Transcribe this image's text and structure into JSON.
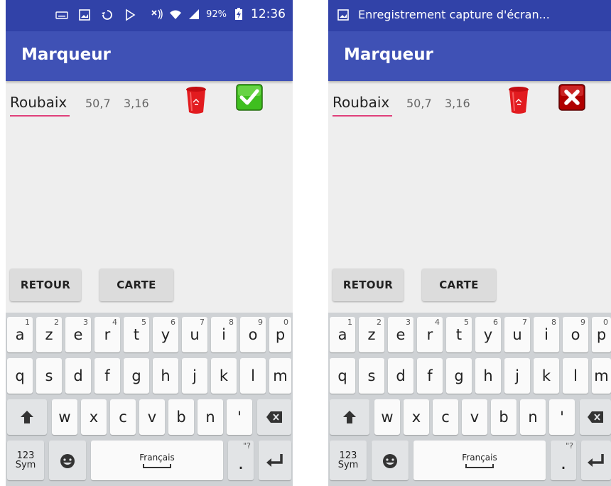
{
  "app": {
    "title": "Marqueur"
  },
  "status_bar": {
    "battery": "92%",
    "time": "12:36"
  },
  "notification": {
    "text": "Enregistrement capture d'écran..."
  },
  "marker": {
    "name": "Roubaix",
    "lat": "50,7",
    "lon": "3,16"
  },
  "icons": {
    "delete": "trash-icon",
    "valid": "check-icon",
    "invalid": "close-icon"
  },
  "colors": {
    "app_bar": "#3f51b5",
    "status_bar": "#3142a8",
    "input_underline": "#e0407a",
    "check_green": "#3fbf1f",
    "error_red": "#b00000"
  },
  "buttons": {
    "back": "RETOUR",
    "map": "CARTE"
  },
  "keyboard": {
    "row1": [
      {
        "key": "a",
        "hint": "1"
      },
      {
        "key": "z",
        "hint": "2"
      },
      {
        "key": "e",
        "hint": "3"
      },
      {
        "key": "r",
        "hint": "4"
      },
      {
        "key": "t",
        "hint": "5"
      },
      {
        "key": "y",
        "hint": "6"
      },
      {
        "key": "u",
        "hint": "7"
      },
      {
        "key": "i",
        "hint": "8"
      },
      {
        "key": "o",
        "hint": "9"
      },
      {
        "key": "p",
        "hint": "0"
      }
    ],
    "row2": [
      "q",
      "s",
      "d",
      "f",
      "g",
      "h",
      "j",
      "k",
      "l",
      "m"
    ],
    "row3": [
      "w",
      "x",
      "c",
      "v",
      "b",
      "n",
      "'"
    ],
    "sym_line1": "123",
    "sym_line2": "Sym",
    "space_label": "Français",
    "period": ".",
    "period_hint": "\"?"
  }
}
